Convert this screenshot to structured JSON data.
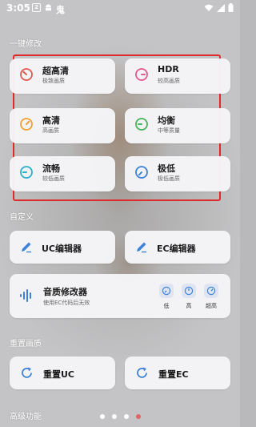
{
  "status_bar": {
    "time": "3:05",
    "notif_badge": "2",
    "app_glyph": "鬼"
  },
  "sections": {
    "one_click": "一键修改",
    "custom": "自定义",
    "reset": "重置画质",
    "advanced": "高级功能"
  },
  "presets": [
    {
      "title": "超高清",
      "subtitle": "极致画质",
      "color": "#e05a4e",
      "icon": "gauge-max-icon"
    },
    {
      "title": "HDR",
      "subtitle": "较高画质",
      "color": "#e05a8c",
      "icon": "gauge-right-icon"
    },
    {
      "title": "高清",
      "subtitle": "高画质",
      "color": "#f0a030",
      "icon": "gauge-icon"
    },
    {
      "title": "均衡",
      "subtitle": "中等质量",
      "color": "#46b35a",
      "icon": "gauge-mid-icon"
    },
    {
      "title": "流畅",
      "subtitle": "较低画质",
      "color": "#28b2c8",
      "icon": "gauge-low-icon"
    },
    {
      "title": "极低",
      "subtitle": "极低画质",
      "color": "#3c82d8",
      "icon": "gauge-min-icon"
    }
  ],
  "editors": {
    "uc": "UC编辑器",
    "ec": "EC编辑器"
  },
  "audio": {
    "title": "音质修改器",
    "subtitle": "使用EC代码后无效",
    "levels": [
      "低",
      "高",
      "超高"
    ]
  },
  "reset_buttons": {
    "uc": "重置UC",
    "ec": "重置EC"
  },
  "pager": {
    "count": 4,
    "active": 3
  },
  "colors": {
    "accent": "#3c82d8",
    "highlight_box": "#e02a2a"
  }
}
